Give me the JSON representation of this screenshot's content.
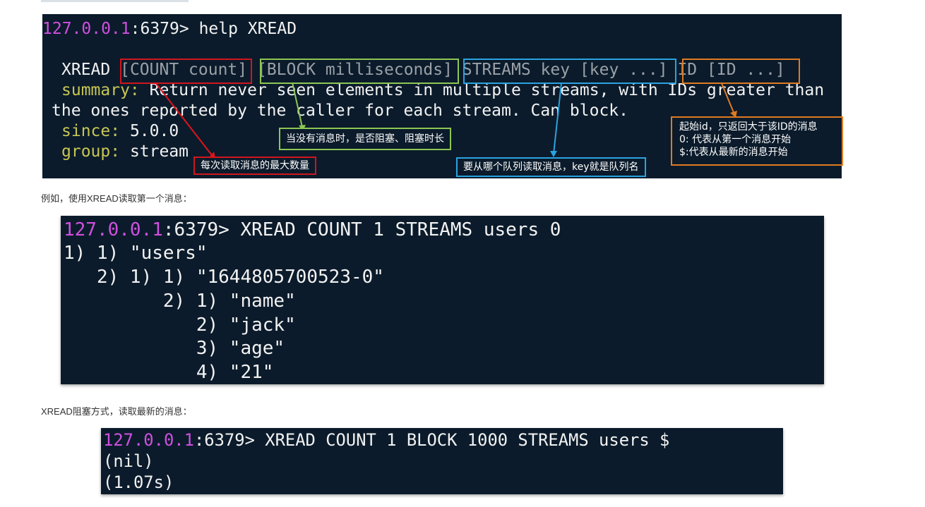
{
  "help_terminal": {
    "prompt_host": "127.0.0.1",
    "prompt_port": ":6379>",
    "command": " help XREAD",
    "cmd_name": "XREAD",
    "args": [
      "[COUNT count]",
      "[BLOCK milliseconds]",
      "STREAMS key [key ...]",
      "ID [ID ...]"
    ],
    "summary_label": "summary:",
    "summary_text": " Return never seen elements in multiple streams, with IDs greater than",
    "summary_cont": "the ones reported by the caller for each stream. Can block.",
    "since_label": "since:",
    "since_value": " 5.0.0",
    "group_label": "group:",
    "group_value": " stream",
    "annotations": {
      "count": "每次读取消息的最大数量",
      "block": "当没有消息时，是否阻塞、阻塞时长",
      "streams": "要从哪个队列读取消息，key就是队列名",
      "id": "起始id，只返回大于该ID的消息\n0: 代表从第一个消息开始\n$:代表从最新的消息开始"
    },
    "colors": {
      "count": "#d0161e",
      "block": "#8cc653",
      "streams": "#2aa3e0",
      "id": "#e07a22"
    }
  },
  "para1": "例如，使用XREAD读取第一个消息：",
  "example1": {
    "prompt_host": "127.0.0.1",
    "prompt_port": ":6379>",
    "command": " XREAD COUNT 1 STREAMS users 0",
    "output": [
      "1) 1) \"users\"",
      "   2) 1) 1) \"1644805700523-0\"",
      "         2) 1) \"name\"",
      "            2) \"jack\"",
      "            3) \"age\"",
      "            4) \"21\""
    ]
  },
  "para2": "XREAD阻塞方式，读取最新的消息：",
  "example2": {
    "prompt_host": "127.0.0.1",
    "prompt_port": ":6379>",
    "command": " XREAD COUNT 1 BLOCK 1000 STREAMS users $",
    "output": [
      "(nil)",
      "(1.07s)"
    ]
  }
}
